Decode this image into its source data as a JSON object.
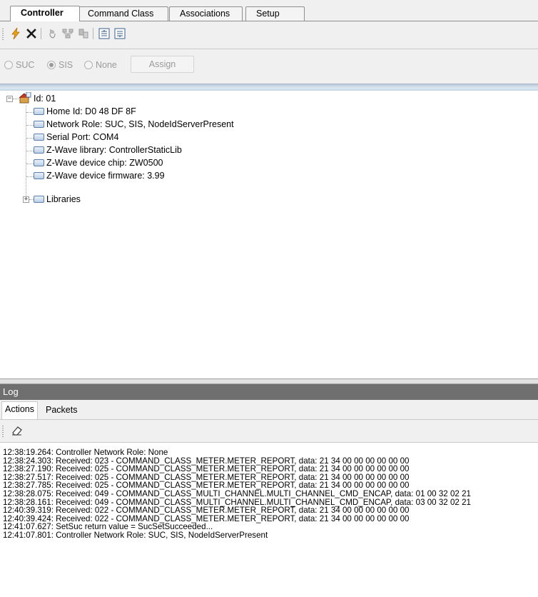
{
  "tabs": [
    {
      "label": "Controller",
      "active": true
    },
    {
      "label": "Command Class",
      "active": false
    },
    {
      "label": "Associations",
      "active": false
    },
    {
      "label": "Setup Route",
      "active": false
    }
  ],
  "toolbar": {
    "icons": [
      "lightning-icon",
      "delete-x-icon",
      "hand-icon",
      "network-icon",
      "shuffle-icon",
      "list-up-icon",
      "list-down-icon"
    ]
  },
  "radio": {
    "options": [
      {
        "label": "SUC",
        "selected": false
      },
      {
        "label": "SIS",
        "selected": true
      },
      {
        "label": "None",
        "selected": false
      }
    ],
    "assign_label": "Assign"
  },
  "tree": {
    "root_label": "Id: 01",
    "children": [
      "Home Id: D0 48 DF 8F",
      "Network Role: SUC, SIS, NodeIdServerPresent",
      "Serial Port: COM4",
      "Z-Wave library: ControllerStaticLib",
      "Z-Wave device chip: ZW0500",
      "Z-Wave device firmware:  3.99",
      "Libraries"
    ]
  },
  "log": {
    "title": "Log",
    "tabs": [
      "Actions",
      "Packets"
    ],
    "lines": [
      "12:38:19.264: Controller Network Role: None",
      "12:38:24.303: Received: 023 - COMMAND_CLASS_METER.METER_REPORT, data: 21 34 00 00 00 00 00 00",
      "12:38:27.190: Received: 025 - COMMAND_CLASS_METER.METER_REPORT, data: 21 34 00 00 00 00 00 00",
      "12:38:27.517: Received: 025 - COMMAND_CLASS_METER.METER_REPORT, data: 21 34 00 00 00 00 00 00",
      "12:38:27.785: Received: 025 - COMMAND_CLASS_METER.METER_REPORT, data: 21 34 00 00 00 00 00 00",
      "12:38:28.075: Received: 049 - COMMAND_CLASS_MULTI_CHANNEL.MULTI_CHANNEL_CMD_ENCAP, data: 01 00 32 02 21",
      "12:38:28.161: Received: 049 - COMMAND_CLASS_MULTI_CHANNEL.MULTI_CHANNEL_CMD_ENCAP, data: 03 00 32 02 21",
      "12:40:39.319: Received: 022 - COMMAND_CLASS_METER.METER_REPORT, data: 21 34 00 00 00 00 00 00",
      "12:40:39.424: Received: 022 - COMMAND_CLASS_METER.METER_REPORT, data: 21 34 00 00 00 00 00 00",
      "12:41:07.627: SetSuc return value = SucSetSucceeded...",
      "12:41:07.801: Controller Network Role: SUC, SIS, NodeIdServerPresent"
    ]
  }
}
